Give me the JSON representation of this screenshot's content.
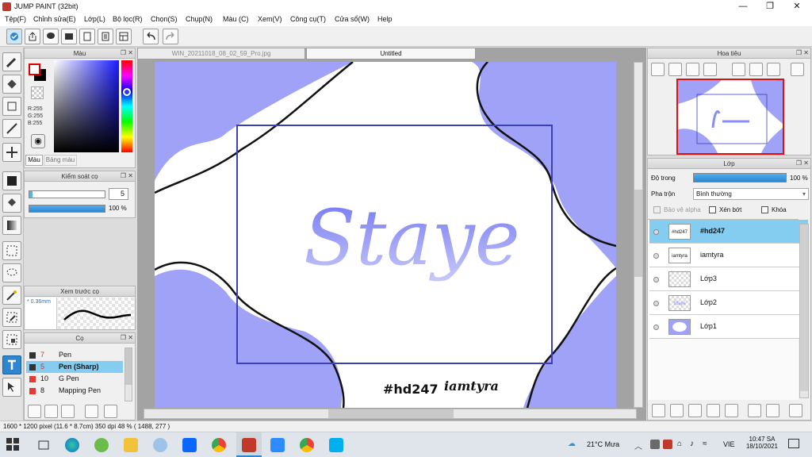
{
  "window": {
    "title": "JUMP PAINT (32bit)",
    "min": "—",
    "max": "❐",
    "close": "✕"
  },
  "menu": [
    "Tệp(F)",
    "Chỉnh sửa(E)",
    "Lớp(L)",
    "Bộ lọc(R)",
    "Chọn(S)",
    "Chụp(N)",
    "Màu (C)",
    "Xem(V)",
    "Công cụ(T)",
    "Cửa sổ(W)",
    "Help"
  ],
  "color_panel": {
    "title": "Màu",
    "r": "R:255",
    "g": "G:255",
    "b": "B:255",
    "tab1": "Màu",
    "tab2": "Bảng màu"
  },
  "brush_control": {
    "title": "Kiểm soát cọ",
    "size": "5",
    "opacity": "100 %"
  },
  "brush_preview": {
    "title": "Xem trước cọ",
    "size": "* 0.36mm"
  },
  "brushes": {
    "title": "Cọ",
    "items": [
      {
        "num": "7",
        "name": "Pen",
        "color": "#e53935"
      },
      {
        "num": "5",
        "name": "Pen (Sharp)",
        "color": "#e53935"
      },
      {
        "num": "10",
        "name": "G Pen",
        "color": "#e53935"
      },
      {
        "num": "8",
        "name": "Mapping Pen",
        "color": "#e53935"
      }
    ]
  },
  "doc_tabs": [
    "WIN_20211018_08_02_59_Pro.jpg",
    "Untitled"
  ],
  "artwork": {
    "title": "Staye",
    "tag": "#hd247",
    "author": "iamtyra"
  },
  "navigator": {
    "title": "Hoa tiêu"
  },
  "layers": {
    "title": "Lớp",
    "opacity_label": "Độ trong",
    "opacity_value": "100 %",
    "blend_label": "Pha trộn",
    "blend_value": "Bình thường",
    "protect_alpha": "Bảo vệ alpha",
    "clip": "Xén bớt",
    "lock": "Khóa",
    "items": [
      {
        "name": "#hd247",
        "thumb": "#hd247"
      },
      {
        "name": "iamtyra",
        "thumb": "iamtyra"
      },
      {
        "name": "Lớp3",
        "thumb": ""
      },
      {
        "name": "Lớp2",
        "thumb": "Staye"
      },
      {
        "name": "Lớp1",
        "thumb": ""
      }
    ]
  },
  "status": {
    "text": "1600 * 1200 pixel   (11.6 * 8.7cm)   350 dpi   48 %   ( 1488, 277 )"
  },
  "taskbar": {
    "weather": "21°C  Mưa",
    "lang": "VIE",
    "time": "10:47 SA",
    "date": "18/10/2021"
  },
  "colors": {
    "accent": "#2e86d1",
    "art_blue": "#9fa2f6",
    "art_line": "#3b3fb8"
  }
}
